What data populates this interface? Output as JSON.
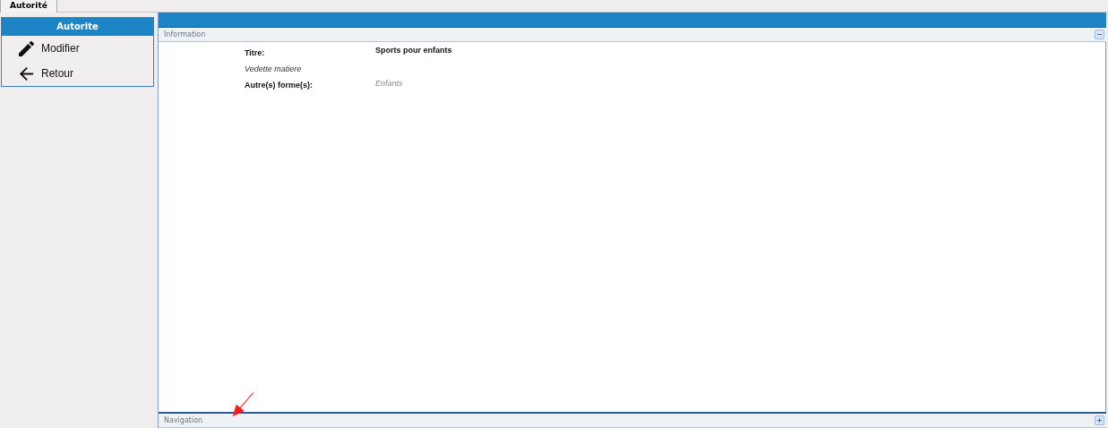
{
  "tabs": [
    {
      "label": "Autorité",
      "selected": true
    }
  ],
  "sidebar": {
    "title": "Autorite",
    "items": [
      {
        "label": "Modifier",
        "kind": "edit"
      },
      {
        "label": "Retour",
        "kind": "back"
      }
    ]
  },
  "sections": [
    {
      "title": "Information",
      "expanded": true,
      "rows": [
        {
          "kind": "field",
          "label": "Titre:",
          "value": "Sports pour enfants"
        },
        {
          "kind": "heading",
          "label": "Vedette matiere"
        },
        {
          "kind": "field-muted",
          "label": "Autre(s) forme(s):",
          "value": "Enfants"
        }
      ]
    },
    {
      "title": "Navigation",
      "expanded": false
    }
  ]
}
